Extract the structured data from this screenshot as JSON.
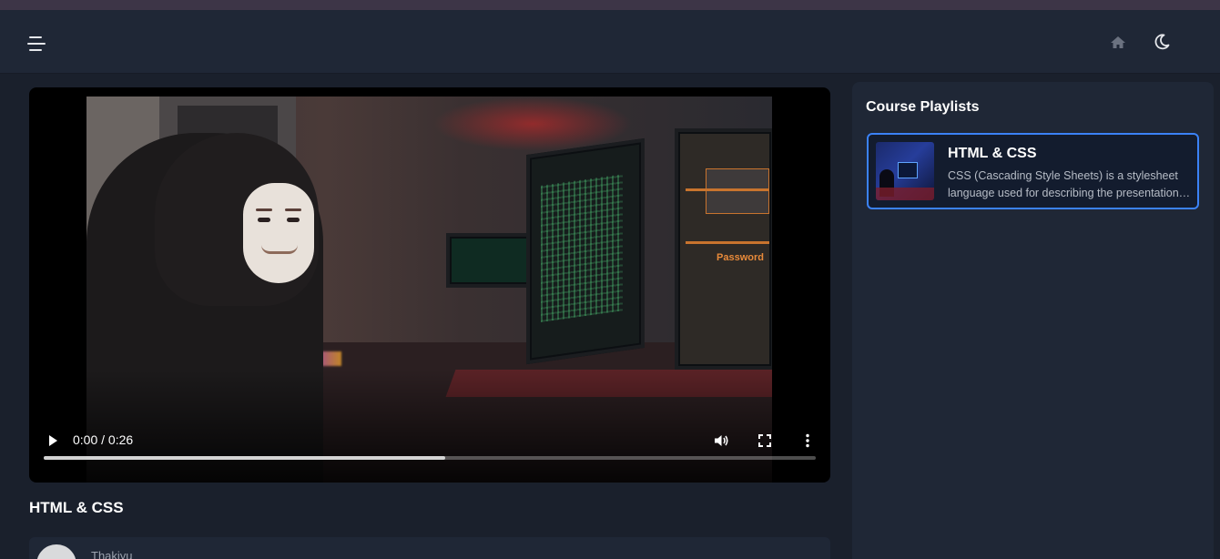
{
  "header": {
    "menu_icon": "hamburger-menu-icon",
    "home_icon": "home-icon",
    "theme_icon": "moon-icon"
  },
  "video": {
    "time": "0:00 / 0:26",
    "progress_fraction": 0.52,
    "title": "HTML & CSS",
    "poster_text": {
      "password": "Password"
    }
  },
  "author": {
    "name": "Thakiyu"
  },
  "sidebar": {
    "title": "Course Playlists",
    "playlists": [
      {
        "title": "HTML & CSS",
        "description": "CSS (Cascading Style Sheets) is a stylesheet language used for describing the presentation of a document written in HTML",
        "active": true
      }
    ]
  },
  "colors": {
    "background": "#1a202c",
    "panel": "#1f2736",
    "accent": "#3b82f6"
  }
}
